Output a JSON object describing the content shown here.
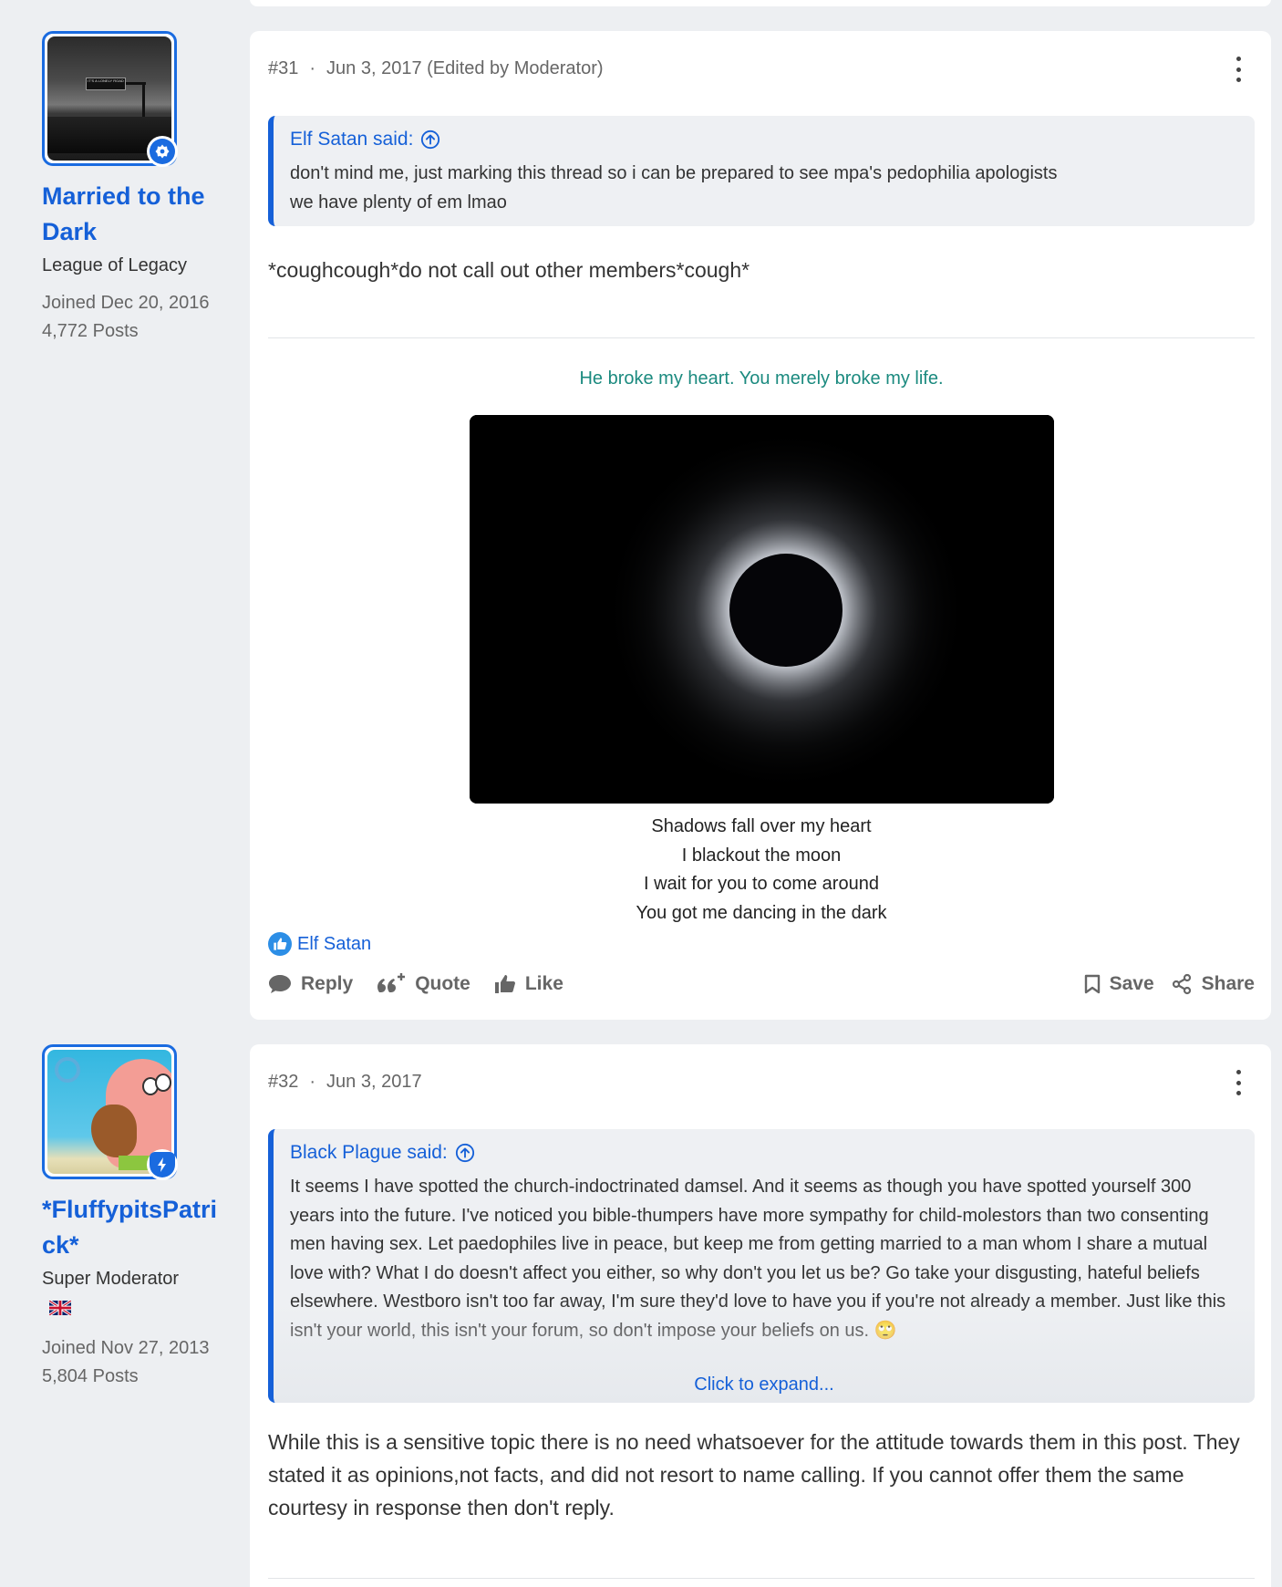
{
  "posts": [
    {
      "user": {
        "name": "Married to the Dark",
        "title": "League of Legacy",
        "joined": "Joined Dec 20, 2016",
        "posts": "4,772 Posts",
        "avatar_sign_text": "IT'S A LONELY ROAD"
      },
      "number": "#31",
      "date": "Jun 3, 2017 (Edited by Moderator)",
      "quote": {
        "author": "Elf Satan said:",
        "lines": [
          "don't mind me, just marking this thread so i can be prepared to see mpa's pedophilia apologists",
          "we have plenty of em lmao"
        ]
      },
      "body": "*coughcough*do not call out other members*cough*",
      "signature": {
        "title": "He broke my heart. You merely broke my life.",
        "lyrics": [
          "Shadows fall over my heart",
          "I blackout the moon",
          "I wait for you to come around",
          "You got me dancing in the dark"
        ]
      },
      "reaction_user": "Elf Satan",
      "actions": {
        "reply": "Reply",
        "quote": "Quote",
        "like": "Like",
        "save": "Save",
        "share": "Share"
      }
    },
    {
      "user": {
        "name": "*FluffypitsPatrick*",
        "title": "Super Moderator",
        "joined": "Joined Nov 27, 2013",
        "posts": "5,804 Posts"
      },
      "number": "#32",
      "date": "Jun 3, 2017",
      "quote": {
        "author": "Black Plague said:",
        "text": "It seems I have spotted the church-indoctrinated damsel. And it seems as though you have spotted yourself 300 years into the future. I've noticed you bible-thumpers have more sympathy for child-molestors than two consenting men having sex. Let paedophiles live in peace, but keep me from getting married to a man whom I share a mutual love with? What I do doesn't affect you either, so why don't you let us be? Go take your disgusting, hateful beliefs elsewhere. Westboro isn't too far away, I'm sure they'd love to have you if you're not already a member. Just like this isn't your world, this isn't your forum, so don't impose your beliefs on us. 🙄",
        "expand": "Click to expand..."
      },
      "body": "While this is a sensitive topic there is no need whatsoever for the attitude towards them in this post. They stated it as opinions,not facts, and did not resort to name calling. If you cannot offer them the same courtesy in response then don't reply."
    }
  ],
  "colors": {
    "accent": "#1560d8",
    "signature_title": "#1b8a7f",
    "background": "#edeff2"
  }
}
